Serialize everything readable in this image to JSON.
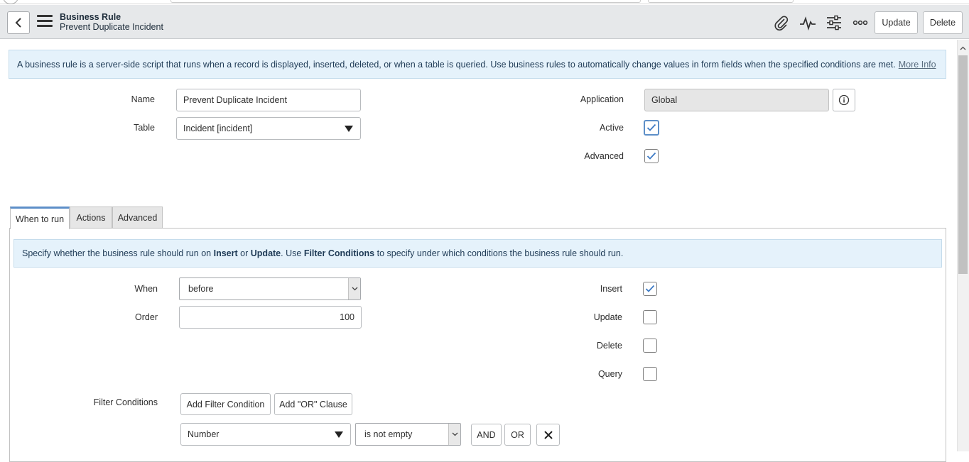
{
  "header": {
    "title": "Business Rule",
    "subtitle": "Prevent Duplicate Incident",
    "update_label": "Update",
    "delete_label": "Delete"
  },
  "info_banner": {
    "text": "A business rule is a server-side script that runs when a record is displayed, inserted, deleted, or when a table is queried. Use business rules to automatically change values in form fields when the specified conditions are met.",
    "link": "More Info"
  },
  "form": {
    "name_label": "Name",
    "name_value": "Prevent Duplicate Incident",
    "table_label": "Table",
    "table_value": "Incident [incident]",
    "application_label": "Application",
    "application_value": "Global",
    "active_label": "Active",
    "active_checked": true,
    "advanced_label": "Advanced",
    "advanced_checked": true
  },
  "tabs": [
    {
      "label": "When to run",
      "active": true
    },
    {
      "label": "Actions",
      "active": false
    },
    {
      "label": "Advanced",
      "active": false
    }
  ],
  "when_to_run": {
    "banner": {
      "t1": "Specify whether the business rule should run on ",
      "b1": "Insert",
      "t2": " or ",
      "b2": "Update",
      "t3": ". Use ",
      "b3": "Filter Conditions",
      "t4": " to specify under which conditions the business rule should run."
    },
    "when_label": "When",
    "when_value": "before",
    "order_label": "Order",
    "order_value": "100",
    "insert_label": "Insert",
    "insert_checked": true,
    "update_label": "Update",
    "update_checked": false,
    "delete_label": "Delete",
    "delete_checked": false,
    "query_label": "Query",
    "query_checked": false,
    "filter_label": "Filter Conditions",
    "add_filter_label": "Add Filter Condition",
    "add_or_label": "Add \"OR\" Clause",
    "condition_field": "Number",
    "condition_operator": "is not empty",
    "and_label": "AND",
    "or_label": "OR"
  },
  "colors": {
    "accent": "#5d8fc8",
    "banner_bg": "#e5f2fb",
    "header_bg": "#e6e8ea"
  }
}
